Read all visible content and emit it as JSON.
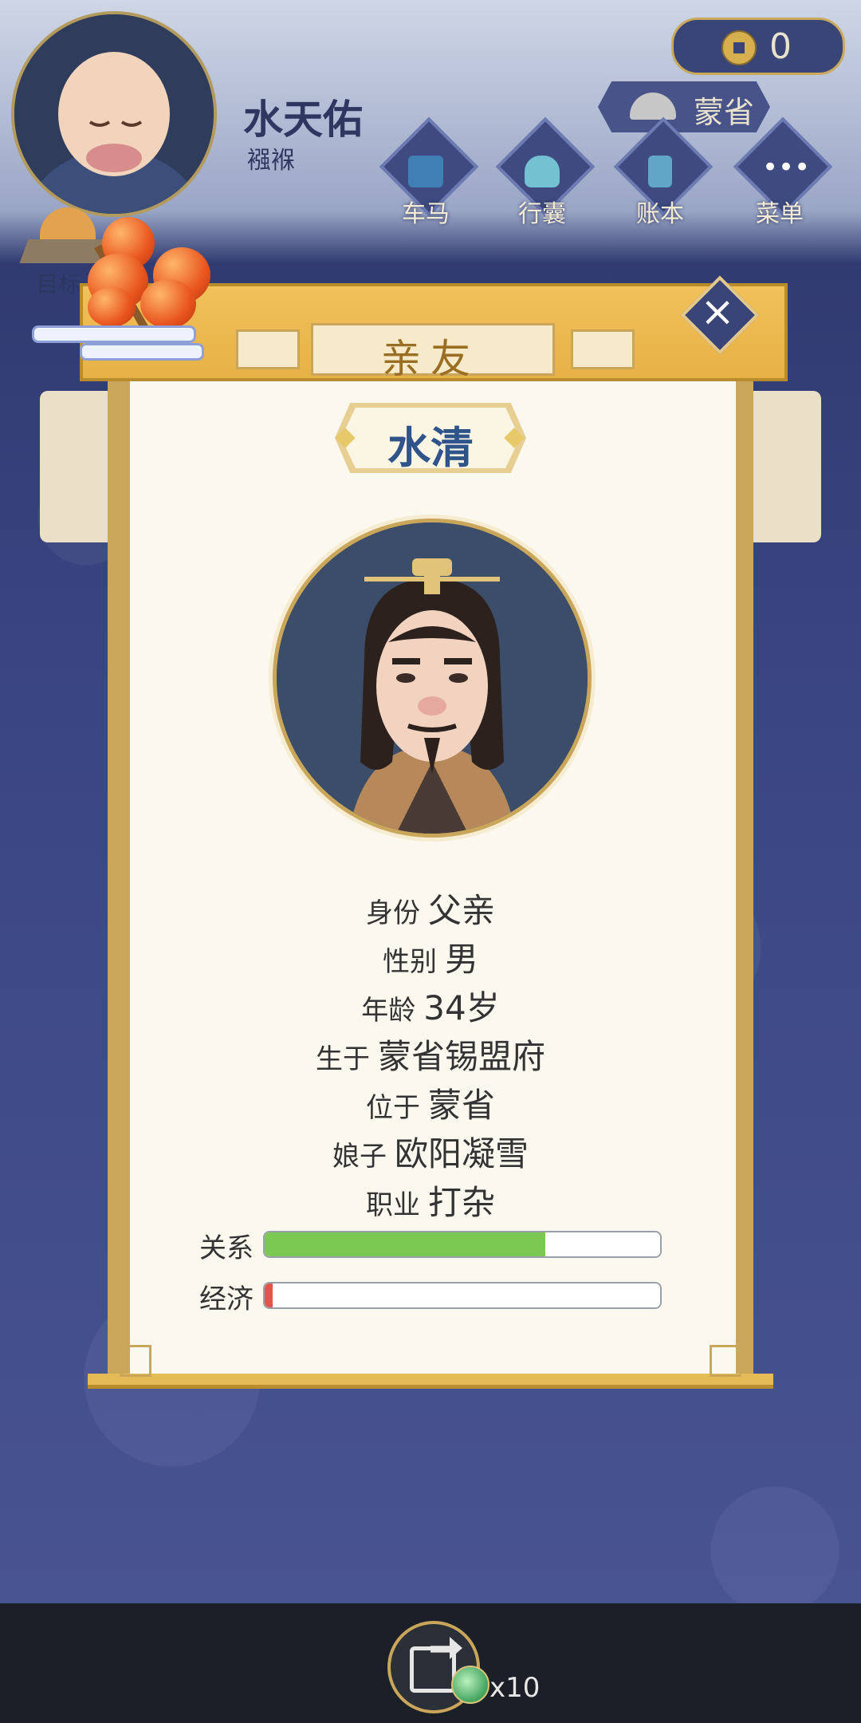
{
  "player": {
    "name": "水天佑",
    "stage": "襁褓"
  },
  "currency": {
    "coins": "0"
  },
  "province_button": {
    "label": "蒙省"
  },
  "nav": [
    {
      "label": "车马",
      "icon": "carriage-icon"
    },
    {
      "label": "行囊",
      "icon": "bag-icon"
    },
    {
      "label": "账本",
      "icon": "ledger-icon"
    },
    {
      "label": "菜单",
      "icon": "menu-icon"
    }
  ],
  "target": {
    "label": "目标"
  },
  "panel": {
    "title": "亲友",
    "person_name": "水清",
    "info": [
      {
        "key": "身份",
        "value": "父亲"
      },
      {
        "key": "性别",
        "value": "男"
      },
      {
        "key": "年龄",
        "value": "34岁"
      },
      {
        "key": "生于",
        "value": "蒙省锡盟府"
      },
      {
        "key": "位于",
        "value": "蒙省"
      },
      {
        "key": "娘子",
        "value": "欧阳凝雪"
      },
      {
        "key": "职业",
        "value": "打杂"
      }
    ],
    "bars": [
      {
        "label": "关系",
        "value": 0.71,
        "color": "#7bc852"
      },
      {
        "label": "经济",
        "value": 0.02,
        "color": "#e3554a"
      }
    ]
  },
  "footer": {
    "multiplier": "x10"
  }
}
